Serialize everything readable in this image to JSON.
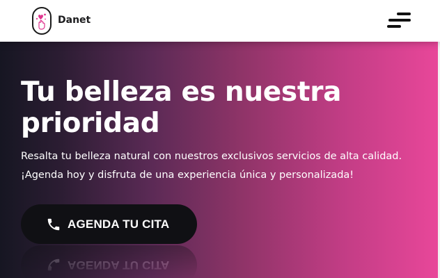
{
  "header": {
    "brand": "Danet",
    "logo_icon": "finger-heart-icon",
    "menu_icon": "hamburger-menu-icon"
  },
  "hero": {
    "title": "Tu belleza es nuestra prioridad",
    "subtitle_line1": "Resalta tu belleza natural con nuestros exclusivos servicios de alta calidad.",
    "subtitle_line2": "¡Agenda hoy y disfruta de una experiencia única y personalizada!",
    "cta_label": "AGENDA TU CITA",
    "cta_icon": "phone-icon"
  },
  "colors": {
    "accent_pink": "#e9479a",
    "dark": "#101014",
    "gradient_start": "#161622"
  }
}
